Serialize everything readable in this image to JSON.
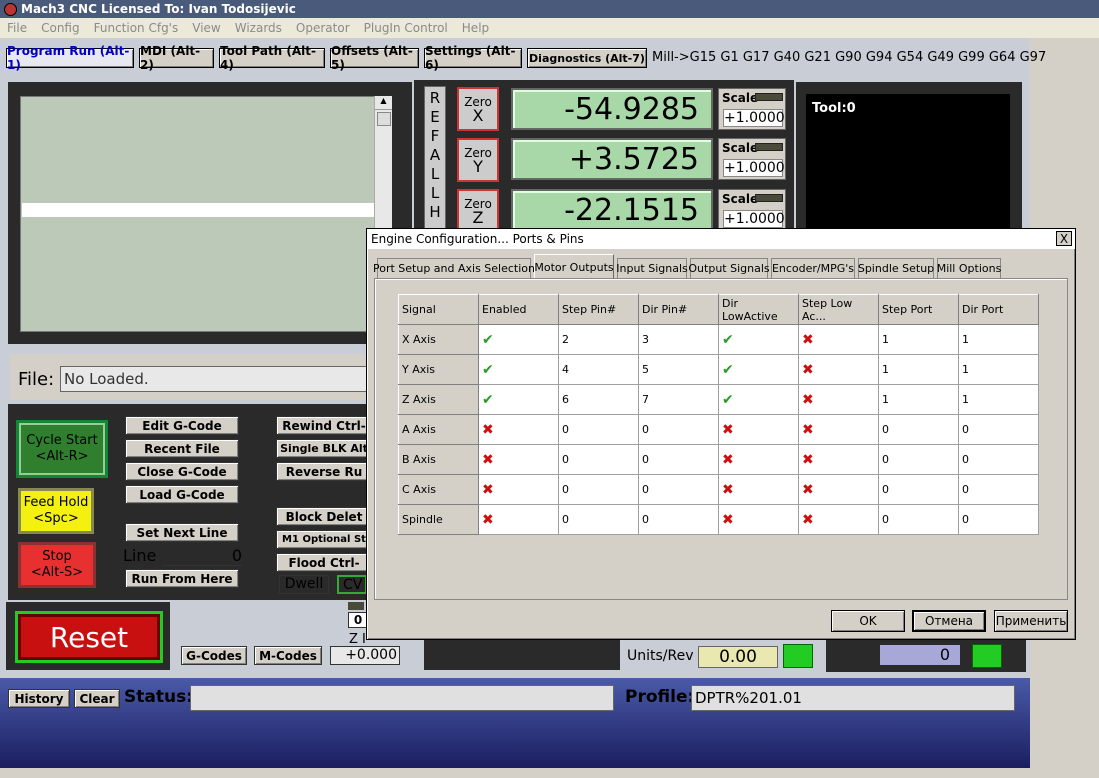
{
  "title": "Mach3 CNC  Licensed To: Ivan Todosijevic",
  "menu": [
    "File",
    "Config",
    "Function Cfg's",
    "View",
    "Wizards",
    "Operator",
    "PlugIn Control",
    "Help"
  ],
  "tabs": {
    "run": "Program Run (Alt-1)",
    "mdi": "MDI (Alt-2)",
    "toolpath": "Tool Path (Alt-4)",
    "offsets": "Offsets (Alt-5)",
    "settings": "Settings (Alt-6)",
    "diagnostics": "Diagnostics (Alt-7)"
  },
  "modal_line": "Mill->G15  G1 G17 G40 G21 G90 G94 G54 G49 G99 G64 G97",
  "ref_all": [
    "R",
    "E",
    "F",
    "A",
    "L",
    "L",
    "H"
  ],
  "axes": [
    {
      "zero": "Zero",
      "axis": "X",
      "value": "-54.9285",
      "scale_label": "Scale",
      "scale": "+1.0000"
    },
    {
      "zero": "Zero",
      "axis": "Y",
      "value": "+3.5725",
      "scale_label": "Scale",
      "scale": "+1.0000"
    },
    {
      "zero": "Zero",
      "axis": "Z",
      "value": "-22.1515",
      "scale_label": "Scale",
      "scale": "+1.0000"
    }
  ],
  "tool": "Tool:0",
  "file": {
    "label": "File:",
    "value": "No Loaded."
  },
  "buttons": {
    "cycle_start": "Cycle Start",
    "cycle_start_key": "<Alt-R>",
    "feed_hold": "Feed Hold",
    "feed_hold_key": "<Spc>",
    "stop": "Stop",
    "stop_key": "<Alt-S>",
    "edit_gcode": "Edit G-Code",
    "recent_file": "Recent File",
    "close_gcode": "Close G-Code",
    "load_gcode": "Load G-Code",
    "set_next_line": "Set Next Line",
    "run_from_here": "Run From Here",
    "rewind": "Rewind Ctrl-",
    "single_blk": "Single BLK Alt",
    "reverse_run": "Reverse Ru",
    "block_delete": "Block Delet",
    "m1_optional": "M1 Optional St",
    "flood": "Flood Ctrl-",
    "dwell": "Dwell",
    "cv": "CV",
    "reset": "Reset",
    "gcodes": "G-Codes",
    "mcodes": "M-Codes",
    "history": "History",
    "clear": "Clear"
  },
  "line": {
    "label": "Line",
    "value": "0"
  },
  "z_value": "+0.000",
  "z_label": "Z I",
  "zero_small": "0",
  "units_rev": {
    "label": "Units/Rev",
    "value": "0.00"
  },
  "spindle_val": "0",
  "status": {
    "label": "Status:",
    "value": ""
  },
  "profile": {
    "label": "Profile:",
    "value": "DPTR%201.01"
  },
  "dialog": {
    "title": "Engine Configuration... Ports & Pins",
    "close": "X",
    "tabs": [
      "Port Setup and Axis Selection",
      "Motor Outputs",
      "Input Signals",
      "Output Signals",
      "Encoder/MPG's",
      "Spindle Setup",
      "Mill Options"
    ],
    "active_tab": 1,
    "columns": [
      "Signal",
      "Enabled",
      "Step Pin#",
      "Dir Pin#",
      "Dir LowActive",
      "Step Low Ac...",
      "Step Port",
      "Dir Port"
    ],
    "rows": [
      {
        "signal": "X Axis",
        "enabled": true,
        "step_pin": "2",
        "dir_pin": "3",
        "dir_low": true,
        "step_low": false,
        "step_port": "1",
        "dir_port": "1"
      },
      {
        "signal": "Y Axis",
        "enabled": true,
        "step_pin": "4",
        "dir_pin": "5",
        "dir_low": true,
        "step_low": false,
        "step_port": "1",
        "dir_port": "1"
      },
      {
        "signal": "Z Axis",
        "enabled": true,
        "step_pin": "6",
        "dir_pin": "7",
        "dir_low": true,
        "step_low": false,
        "step_port": "1",
        "dir_port": "1"
      },
      {
        "signal": "A Axis",
        "enabled": false,
        "step_pin": "0",
        "dir_pin": "0",
        "dir_low": false,
        "step_low": false,
        "step_port": "0",
        "dir_port": "0"
      },
      {
        "signal": "B Axis",
        "enabled": false,
        "step_pin": "0",
        "dir_pin": "0",
        "dir_low": false,
        "step_low": false,
        "step_port": "0",
        "dir_port": "0"
      },
      {
        "signal": "C Axis",
        "enabled": false,
        "step_pin": "0",
        "dir_pin": "0",
        "dir_low": false,
        "step_low": false,
        "step_port": "0",
        "dir_port": "0"
      },
      {
        "signal": "Spindle",
        "enabled": false,
        "step_pin": "0",
        "dir_pin": "0",
        "dir_low": false,
        "step_low": false,
        "step_port": "0",
        "dir_port": "0"
      }
    ],
    "ok": "OK",
    "cancel": "Отмена",
    "apply": "Применить"
  }
}
